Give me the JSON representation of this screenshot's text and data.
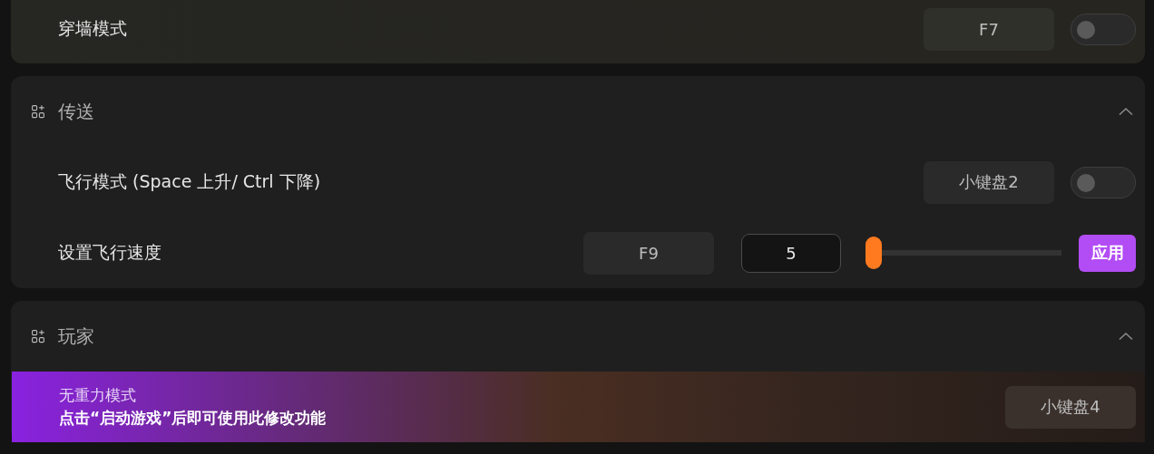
{
  "sections": [
    {
      "rows": [
        {
          "kind": "toggle",
          "label": "穿墙模式",
          "hotkey": "F7",
          "on": false
        }
      ]
    },
    {
      "title": "传送",
      "expanded": true,
      "rows": [
        {
          "kind": "toggle",
          "label": "飞行模式 (Space 上升/ Ctrl 下降)",
          "hotkey": "小键盘2",
          "on": false
        },
        {
          "kind": "slider",
          "label": "设置飞行速度",
          "hotkey": "F9",
          "value": "5",
          "level": 0,
          "action": "应用"
        }
      ]
    },
    {
      "title": "玩家",
      "expanded": true,
      "rows": [
        {
          "kind": "locked",
          "label": "无重力模式",
          "notice": "点击“启动游戏”后即可使用此修改功能",
          "hotkey": "小键盘4"
        }
      ]
    }
  ]
}
